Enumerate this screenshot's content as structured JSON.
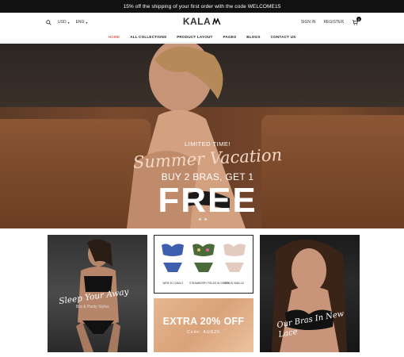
{
  "announcement": "15% off the shipping of your first order with the code WELCOME15",
  "header": {
    "currency": "USD",
    "language": "ENG",
    "brand": "KALA",
    "sign_in": "SIGN IN",
    "register": "REGISTER",
    "cart_count": "0"
  },
  "nav": [
    "HOME",
    "ALL COLLECTIONS",
    "PRODUCT LAYOUT",
    "PAGES",
    "BLOGS",
    "CONTACT US"
  ],
  "hero": {
    "limited": "LIMITED TIME!",
    "script": "Summer Vacation",
    "offer": "BUY 2 BRAS, GET 1",
    "free": "FREE"
  },
  "tiles": {
    "sleep": {
      "caption": "Sleep Your Away",
      "sub": "Bra & Panty Styles"
    },
    "products": [
      "WIRE IN COBALT",
      "STRAWBERRY FIELDS IN GREEN",
      "ZEN IN VANILLA"
    ],
    "promo": {
      "title": "EXTRA 20% OFF",
      "code": "Code: AUG20"
    },
    "lace": {
      "caption": "Our Bras In New Lace"
    }
  },
  "colors": {
    "accent": "#d86a55",
    "topbar": "#111111"
  }
}
